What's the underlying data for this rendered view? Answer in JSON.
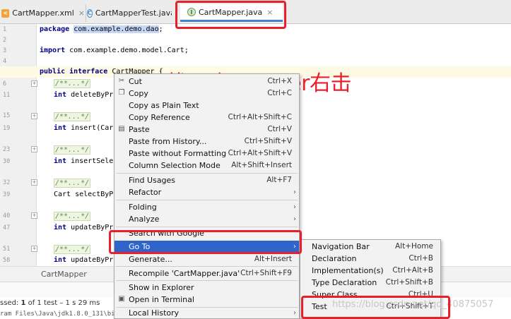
{
  "tabs": [
    {
      "label": "CartMapper.xml",
      "icon": "xml-file-icon",
      "close": "×"
    },
    {
      "label": "CartMapperTest.java",
      "icon": "class-c-icon",
      "icon_text": "C"
    },
    {
      "label": "CartMapper.java",
      "icon": "interface-i-icon",
      "icon_text": "I",
      "close": "×",
      "active": true
    }
  ],
  "editor": {
    "lines": [
      {
        "num": "1",
        "pre": "",
        "kw": "package",
        "hl": "com.example.demo.dao",
        "post": ";"
      },
      {
        "num": "2",
        "text": ""
      },
      {
        "num": "3",
        "kw": "import",
        "post": " com.example.demo.model.Cart;"
      },
      {
        "num": "4",
        "text": ""
      },
      {
        "num": "5",
        "kw": "public interface",
        "post": " CartMapper {"
      },
      {
        "num": "6",
        "comment": "/**...*/"
      },
      {
        "num": "11",
        "kw": "int",
        "post": " deleteByPrim"
      },
      {
        "num": "15",
        "comment": "/**...*/"
      },
      {
        "num": "19",
        "kw": "int",
        "post": " insert(Cart"
      },
      {
        "num": "23",
        "comment": "/**...*/"
      },
      {
        "num": "30",
        "kw": "int",
        "post": " insertSelect"
      },
      {
        "num": "32",
        "comment": "/**...*/"
      },
      {
        "num": "39",
        "text": "Cart selectByPri"
      },
      {
        "num": "40",
        "comment": "/**...*/"
      },
      {
        "num": "47",
        "kw": "int",
        "post": " updateByPrim"
      },
      {
        "num": "51",
        "comment": "/**...*/"
      },
      {
        "num": "58",
        "kw": "int",
        "post": " updateByPrim"
      }
    ]
  },
  "breadcrumb": "CartMapper",
  "run": {
    "status_prefix": "ssed: ",
    "status_bold": "1",
    "status_suffix": " of 1 test – 1 s 29 ms",
    "cmd": "ram Files\\Java\\jdk1.8.0_131\\bi"
  },
  "annotation": "找一个mapper右击",
  "context_menu": [
    {
      "label": "Cut",
      "shortcut": "Ctrl+X",
      "icon": "scissors-icon"
    },
    {
      "label": "Copy",
      "shortcut": "Ctrl+C",
      "icon": "copy-icon"
    },
    {
      "label": "Copy as Plain Text",
      "shortcut": ""
    },
    {
      "label": "Copy Reference",
      "shortcut": "Ctrl+Alt+Shift+C"
    },
    {
      "label": "Paste",
      "shortcut": "Ctrl+V",
      "icon": "clipboard-icon"
    },
    {
      "label": "Paste from History...",
      "shortcut": "Ctrl+Shift+V"
    },
    {
      "label": "Paste without Formatting",
      "shortcut": "Ctrl+Alt+Shift+V"
    },
    {
      "label": "Column Selection Mode",
      "shortcut": "Alt+Shift+Insert"
    },
    {
      "label": "Find Usages",
      "shortcut": "Alt+F7"
    },
    {
      "label": "Refactor",
      "submenu": true
    },
    {
      "label": "Folding",
      "submenu": true
    },
    {
      "label": "Analyze",
      "submenu": true
    },
    {
      "label": "Search with Google",
      "shortcut": ""
    },
    {
      "label": "Go To",
      "submenu": true,
      "selected": true
    },
    {
      "label": "Generate...",
      "shortcut": "Alt+Insert"
    },
    {
      "label": "Recompile 'CartMapper.java'",
      "shortcut": "Ctrl+Shift+F9"
    },
    {
      "label": "Show in Explorer",
      "shortcut": ""
    },
    {
      "label": "Open in Terminal",
      "shortcut": "",
      "icon": "terminal-icon"
    },
    {
      "label": "Local History",
      "submenu": true
    }
  ],
  "goto_submenu": [
    {
      "label": "Navigation Bar",
      "shortcut": "Alt+Home"
    },
    {
      "label": "Declaration",
      "shortcut": "Ctrl+B"
    },
    {
      "label": "Implementation(s)",
      "shortcut": "Ctrl+Alt+B"
    },
    {
      "label": "Type Declaration",
      "shortcut": "Ctrl+Shift+B"
    },
    {
      "label": "Super Class",
      "shortcut": "Ctrl+U"
    },
    {
      "label": "Test",
      "shortcut": "Ctrl+Shift+T"
    }
  ],
  "watermark": "https://blog.csdn.net/qq_40875057",
  "colors": {
    "annotation": "#e8202a",
    "selection": "#2f65ca"
  }
}
